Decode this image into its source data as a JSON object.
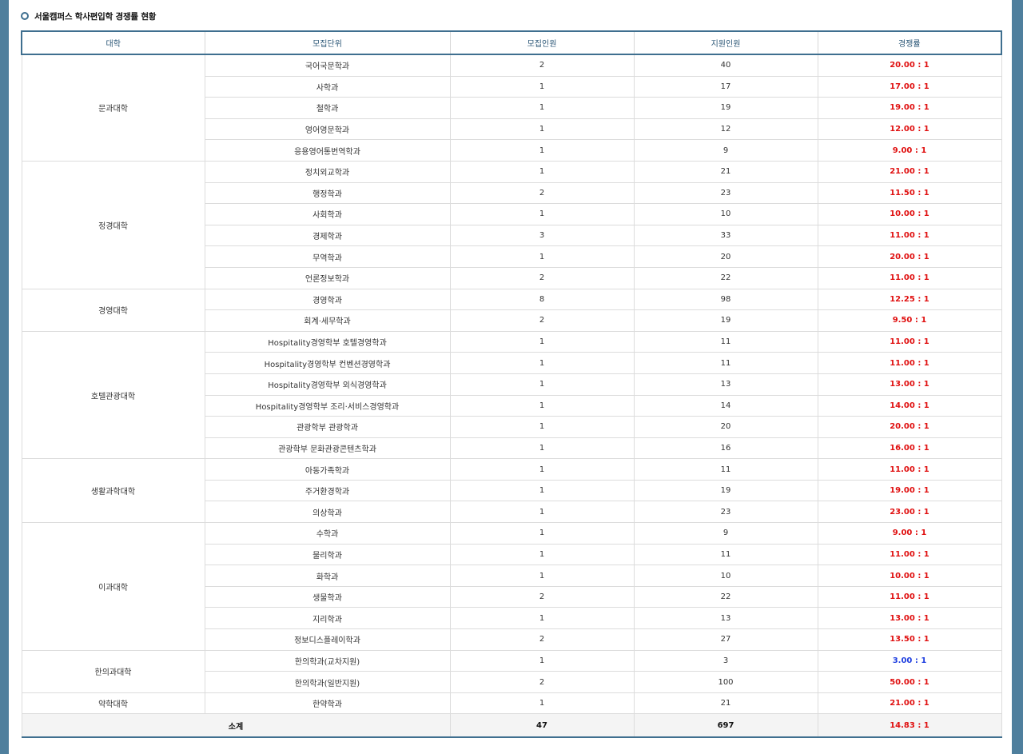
{
  "title": "서울캠퍼스 학사편입학 경쟁률 현황",
  "columns": [
    "대학",
    "모집단위",
    "모집인원",
    "지원인원",
    "경쟁률"
  ],
  "groups": [
    {
      "college": "문과대학",
      "rows": [
        {
          "unit": "국어국문학과",
          "quota": "2",
          "applicants": "40",
          "ratio": "20.00 : 1"
        },
        {
          "unit": "사학과",
          "quota": "1",
          "applicants": "17",
          "ratio": "17.00 : 1"
        },
        {
          "unit": "철학과",
          "quota": "1",
          "applicants": "19",
          "ratio": "19.00 : 1"
        },
        {
          "unit": "영어영문학과",
          "quota": "1",
          "applicants": "12",
          "ratio": "12.00 : 1"
        },
        {
          "unit": "응용영어통번역학과",
          "quota": "1",
          "applicants": "9",
          "ratio": "9.00 : 1"
        }
      ]
    },
    {
      "college": "정경대학",
      "rows": [
        {
          "unit": "정치외교학과",
          "quota": "1",
          "applicants": "21",
          "ratio": "21.00 : 1"
        },
        {
          "unit": "행정학과",
          "quota": "2",
          "applicants": "23",
          "ratio": "11.50 : 1"
        },
        {
          "unit": "사회학과",
          "quota": "1",
          "applicants": "10",
          "ratio": "10.00 : 1"
        },
        {
          "unit": "경제학과",
          "quota": "3",
          "applicants": "33",
          "ratio": "11.00 : 1"
        },
        {
          "unit": "무역학과",
          "quota": "1",
          "applicants": "20",
          "ratio": "20.00 : 1"
        },
        {
          "unit": "언론정보학과",
          "quota": "2",
          "applicants": "22",
          "ratio": "11.00 : 1"
        }
      ]
    },
    {
      "college": "경영대학",
      "rows": [
        {
          "unit": "경영학과",
          "quota": "8",
          "applicants": "98",
          "ratio": "12.25 : 1"
        },
        {
          "unit": "회계·세무학과",
          "quota": "2",
          "applicants": "19",
          "ratio": "9.50 : 1"
        }
      ]
    },
    {
      "college": "호텔관광대학",
      "rows": [
        {
          "unit": "Hospitality경영학부 호텔경영학과",
          "quota": "1",
          "applicants": "11",
          "ratio": "11.00 : 1"
        },
        {
          "unit": "Hospitality경영학부 컨벤션경영학과",
          "quota": "1",
          "applicants": "11",
          "ratio": "11.00 : 1"
        },
        {
          "unit": "Hospitality경영학부 외식경영학과",
          "quota": "1",
          "applicants": "13",
          "ratio": "13.00 : 1"
        },
        {
          "unit": "Hospitality경영학부 조리·서비스경영학과",
          "quota": "1",
          "applicants": "14",
          "ratio": "14.00 : 1"
        },
        {
          "unit": "관광학부 관광학과",
          "quota": "1",
          "applicants": "20",
          "ratio": "20.00 : 1"
        },
        {
          "unit": "관광학부 문화관광콘텐츠학과",
          "quota": "1",
          "applicants": "16",
          "ratio": "16.00 : 1"
        }
      ]
    },
    {
      "college": "생활과학대학",
      "rows": [
        {
          "unit": "아동가족학과",
          "quota": "1",
          "applicants": "11",
          "ratio": "11.00 : 1"
        },
        {
          "unit": "주거환경학과",
          "quota": "1",
          "applicants": "19",
          "ratio": "19.00 : 1"
        },
        {
          "unit": "의상학과",
          "quota": "1",
          "applicants": "23",
          "ratio": "23.00 : 1"
        }
      ]
    },
    {
      "college": "이과대학",
      "rows": [
        {
          "unit": "수학과",
          "quota": "1",
          "applicants": "9",
          "ratio": "9.00 : 1"
        },
        {
          "unit": "물리학과",
          "quota": "1",
          "applicants": "11",
          "ratio": "11.00 : 1"
        },
        {
          "unit": "화학과",
          "quota": "1",
          "applicants": "10",
          "ratio": "10.00 : 1"
        },
        {
          "unit": "생물학과",
          "quota": "2",
          "applicants": "22",
          "ratio": "11.00 : 1"
        },
        {
          "unit": "지리학과",
          "quota": "1",
          "applicants": "13",
          "ratio": "13.00 : 1"
        },
        {
          "unit": "정보디스플레이학과",
          "quota": "2",
          "applicants": "27",
          "ratio": "13.50 : 1"
        }
      ]
    },
    {
      "college": "한의과대학",
      "rows": [
        {
          "unit": "한의학과(교차지원)",
          "quota": "1",
          "applicants": "3",
          "ratio": "3.00 : 1",
          "ratio_color": "blue"
        },
        {
          "unit": "한의학과(일반지원)",
          "quota": "2",
          "applicants": "100",
          "ratio": "50.00 : 1"
        }
      ]
    },
    {
      "college": "약학대학",
      "rows": [
        {
          "unit": "한약학과",
          "quota": "1",
          "applicants": "21",
          "ratio": "21.00 : 1"
        }
      ]
    }
  ],
  "total": {
    "label": "소계",
    "quota": "47",
    "applicants": "697",
    "ratio": "14.83 : 1"
  },
  "colors": {
    "background": "#4f7f9d",
    "header_accent": "#3f6f8f",
    "ratio_red": "#e01010",
    "ratio_blue": "#1f3fe0"
  }
}
